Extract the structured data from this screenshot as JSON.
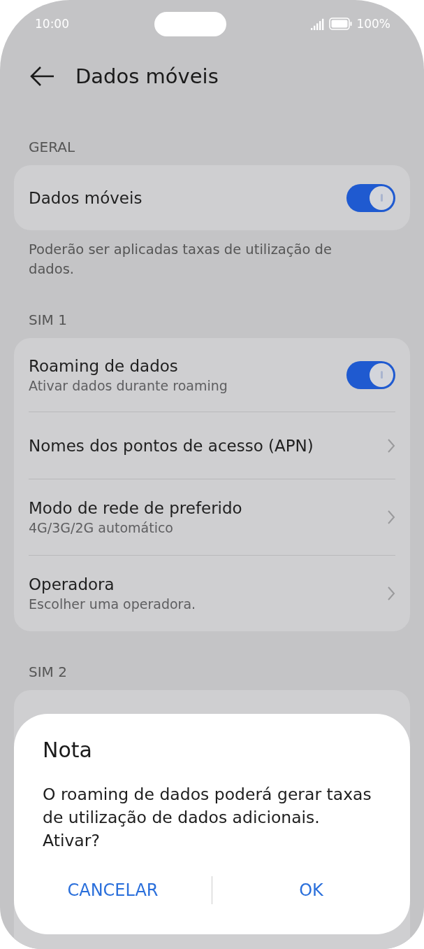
{
  "status_bar": {
    "time": "10:00",
    "battery": "100%"
  },
  "header": {
    "title": "Dados móveis"
  },
  "sections": [
    {
      "heading": "GERAL",
      "items": [
        {
          "kind": "toggle",
          "title": "Dados móveis",
          "on": true
        }
      ],
      "note": "Poderão ser aplicadas taxas de utilização de dados."
    },
    {
      "heading": "SIM 1",
      "items": [
        {
          "kind": "toggle",
          "title": "Roaming de dados",
          "subtitle": "Ativar dados durante roaming",
          "on": true
        },
        {
          "kind": "link",
          "title": "Nomes dos pontos de acesso (APN)"
        },
        {
          "kind": "link",
          "title": "Modo de rede de preferido",
          "subtitle": "4G/3G/2G automático"
        },
        {
          "kind": "link",
          "title": "Operadora",
          "subtitle": "Escolher uma operadora."
        }
      ]
    },
    {
      "heading": "SIM 2"
    }
  ],
  "dialog": {
    "title": "Nota",
    "message": "O roaming de dados poderá gerar taxas de utilização de dados adicionais. Ativar?",
    "buttons": [
      "CANCELAR",
      "OK"
    ]
  }
}
